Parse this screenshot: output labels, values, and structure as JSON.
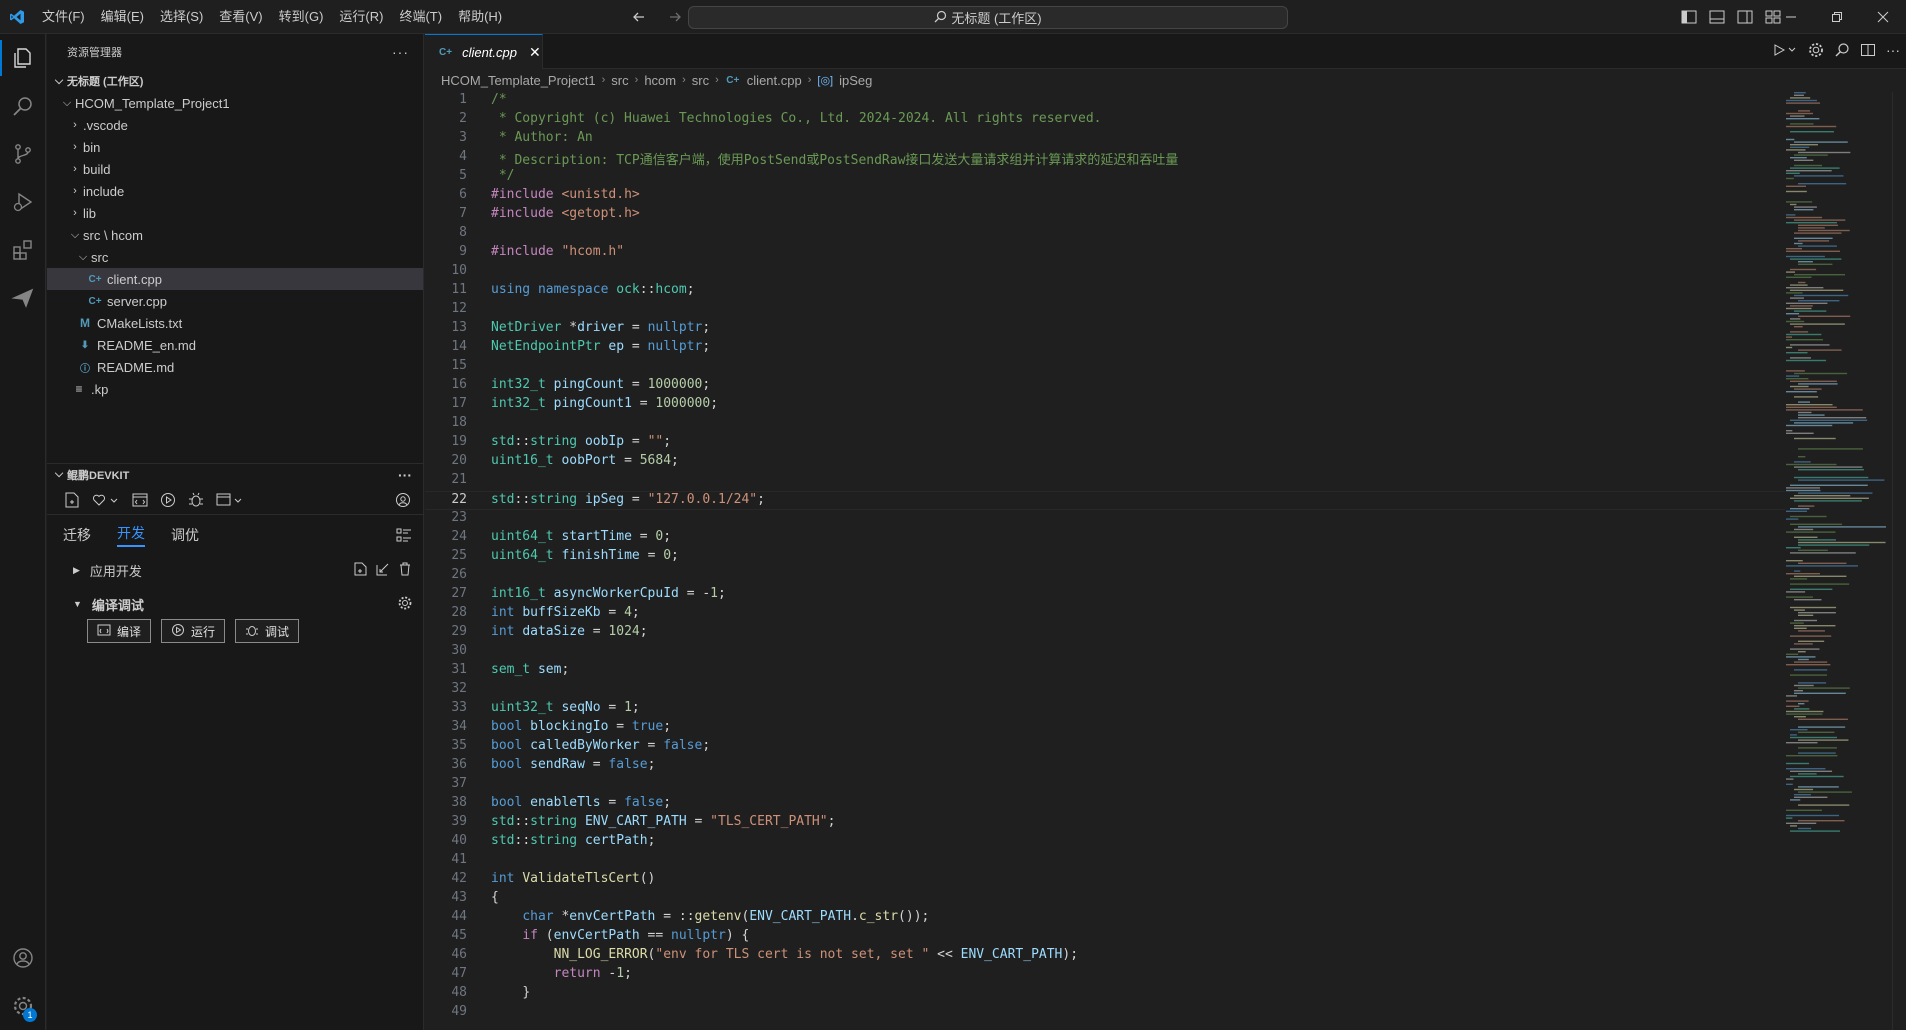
{
  "menu": [
    "文件(F)",
    "编辑(E)",
    "选择(S)",
    "查看(V)",
    "转到(G)",
    "运行(R)",
    "终端(T)",
    "帮助(H)"
  ],
  "search": {
    "text": "无标题 (工作区)"
  },
  "sidebar": {
    "title": "资源管理器",
    "workspace": "无标题 (工作区)",
    "project": "HCOM_Template_Project1",
    "tree": [
      {
        "label": ".vscode",
        "type": "folder"
      },
      {
        "label": "bin",
        "type": "folder"
      },
      {
        "label": "build",
        "type": "folder"
      },
      {
        "label": "include",
        "type": "folder"
      },
      {
        "label": "lib",
        "type": "folder"
      },
      {
        "label": "src \\ hcom",
        "type": "folder-open"
      },
      {
        "label": "src",
        "type": "folder-open"
      },
      {
        "label": "client.cpp",
        "type": "cpp"
      },
      {
        "label": "server.cpp",
        "type": "cpp"
      },
      {
        "label": "CMakeLists.txt",
        "type": "cmake"
      },
      {
        "label": "README_en.md",
        "type": "md-down"
      },
      {
        "label": "README.md",
        "type": "info"
      },
      {
        "label": ".kp",
        "type": "lines"
      }
    ]
  },
  "devkit": {
    "title": "鲲鹏DEVKIT",
    "tabs": [
      "迁移",
      "开发",
      "调优"
    ],
    "active_tab": "开发",
    "app_dev": "应用开发",
    "build_debug": "编译调试",
    "buttons": {
      "compile": "编译",
      "run": "运行",
      "debug": "调试"
    }
  },
  "activity_badge": "1",
  "editor": {
    "tab": "client.cpp",
    "breadcrumb": [
      "HCOM_Template_Project1",
      "src",
      "hcom",
      "src",
      "client.cpp",
      "ipSeg"
    ],
    "current_line": 22,
    "lines": [
      "/*",
      " * Copyright (c) Huawei Technologies Co., Ltd. 2024-2024. All rights reserved.",
      " * Author: An",
      " * Description: TCP通信客户端，使用PostSend或PostSendRaw接口发送大量请求组并计算请求的延迟和吞吐量",
      " */",
      "#include <unistd.h>",
      "#include <getopt.h>",
      "",
      "#include \"hcom.h\"",
      "",
      "using namespace ock::hcom;",
      "",
      "NetDriver *driver = nullptr;",
      "NetEndpointPtr ep = nullptr;",
      "",
      "int32_t pingCount = 1000000;",
      "int32_t pingCount1 = 1000000;",
      "",
      "std::string oobIp = \"\";",
      "uint16_t oobPort = 5684;",
      "",
      "std::string ipSeg = \"127.0.0.1/24\";",
      "",
      "uint64_t startTime = 0;",
      "uint64_t finishTime = 0;",
      "",
      "int16_t asyncWorkerCpuId = -1;",
      "int buffSizeKb = 4;",
      "int dataSize = 1024;",
      "",
      "sem_t sem;",
      "",
      "uint32_t seqNo = 1;",
      "bool blockingIo = true;",
      "bool calledByWorker = false;",
      "bool sendRaw = false;",
      "",
      "bool enableTls = false;",
      "std::string ENV_CART_PATH = \"TLS_CERT_PATH\";",
      "std::string certPath;",
      "",
      "int ValidateTlsCert()",
      "{",
      "    char *envCertPath = ::getenv(ENV_CART_PATH.c_str());",
      "    if (envCertPath == nullptr) {",
      "        NN_LOG_ERROR(\"env for TLS cert is not set, set \" << ENV_CART_PATH);",
      "        return -1;",
      "    }",
      ""
    ]
  }
}
